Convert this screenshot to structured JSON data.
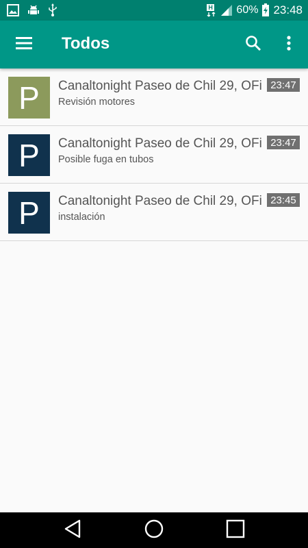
{
  "status_bar": {
    "icons_left": [
      "image-icon",
      "android-debug-icon",
      "usb-icon"
    ],
    "network_label": "H",
    "battery_percent": "60%",
    "time": "23:48"
  },
  "app_bar": {
    "title": "Todos",
    "icons": [
      "menu-icon",
      "search-icon",
      "more-vert-icon"
    ]
  },
  "colors": {
    "status_bar": "#00806f",
    "app_bar": "#009787",
    "avatar_olive": "#8c9a5c",
    "avatar_navy": "#10324d",
    "time_badge": "#707070"
  },
  "items": [
    {
      "avatar_letter": "P",
      "avatar_color": "#8c9a5c",
      "title": "Canaltonight Paseo de Chil 29, OFi…",
      "subtitle": "Revisión motores",
      "time": "23:47"
    },
    {
      "avatar_letter": "P",
      "avatar_color": "#10324d",
      "title": "Canaltonight Paseo de Chil 29, OFi…",
      "subtitle": "Posible fuga en tubos",
      "time": "23:47"
    },
    {
      "avatar_letter": "P",
      "avatar_color": "#10324d",
      "title": "Canaltonight Paseo de Chil 29, OFi…",
      "subtitle": "instalación",
      "time": "23:45"
    }
  ],
  "nav_bar": {
    "icons": [
      "back-icon",
      "home-icon",
      "recents-icon"
    ]
  }
}
